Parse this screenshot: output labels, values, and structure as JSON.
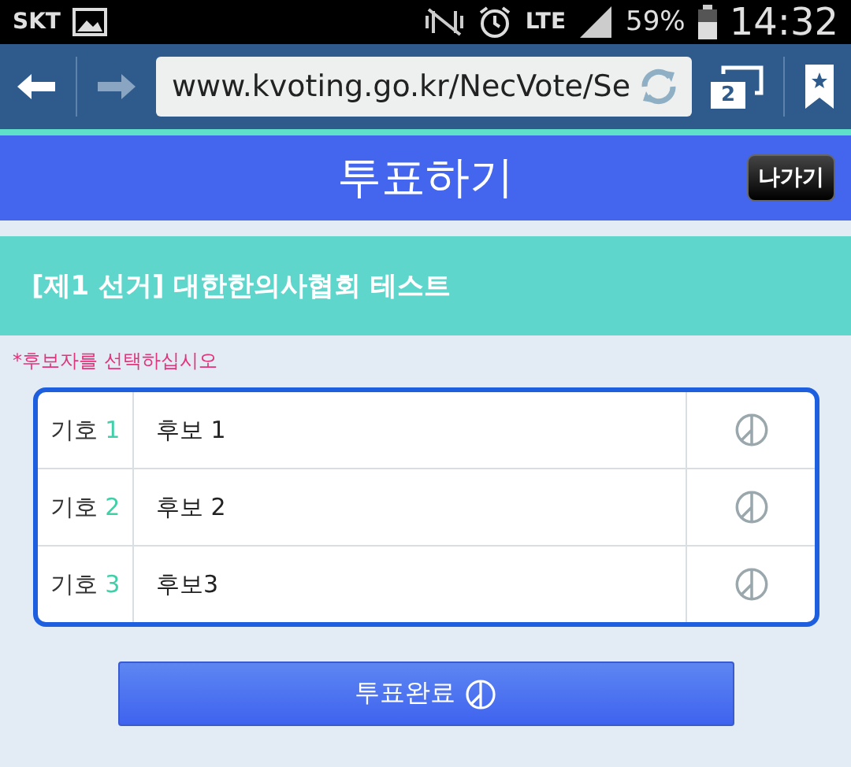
{
  "status_bar": {
    "carrier": "SKT",
    "network": "LTE",
    "battery": "59%",
    "time": "14:32"
  },
  "browser": {
    "url": "www.kvoting.go.kr/NecVote/Se",
    "tab_count": "2"
  },
  "header": {
    "title": "투표하기",
    "exit_button": "나가기"
  },
  "election": {
    "title": "[제1 선거] 대한한의사협회 테스트"
  },
  "instruction": "*후보자를 선택하십시오",
  "candidates": [
    {
      "label": "기호",
      "number": "1",
      "name": "후보 1"
    },
    {
      "label": "기호",
      "number": "2",
      "name": "후보 2"
    },
    {
      "label": "기호",
      "number": "3",
      "name": "후보3"
    }
  ],
  "submit_button": "투표완료"
}
